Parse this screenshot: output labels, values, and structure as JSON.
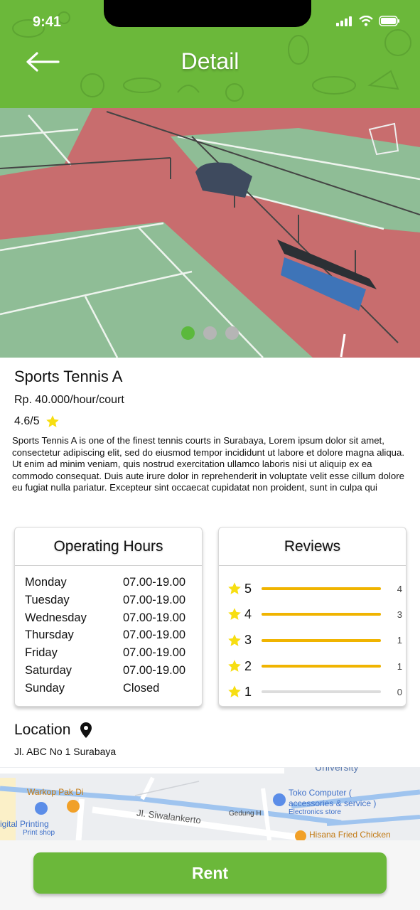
{
  "status_bar": {
    "time": "9:41"
  },
  "header": {
    "title": "Detail",
    "back_icon": "arrow-left-icon",
    "accent": "#6bb83a"
  },
  "hero": {
    "slide_count": 3,
    "active_slide": 1,
    "active_color": "#5bb93c"
  },
  "venue": {
    "name": "Sports Tennis A",
    "price": "Rp. 40.000/hour/court",
    "rating": "4.6/5",
    "description": "Sports Tennis A is one of the finest tennis courts in Surabaya, Lorem ipsum dolor sit amet, consectetur adipiscing elit, sed do eiusmod tempor incididunt ut labore et dolore magna aliqua. Ut enim ad minim veniam, quis nostrud exercitation ullamco laboris nisi ut aliquip ex ea commodo consequat. Duis aute irure dolor in reprehenderit in voluptate velit esse cillum dolore eu fugiat nulla pariatur. Excepteur sint occaecat cupidatat non proident, sunt in culpa qui"
  },
  "operating_hours": {
    "title": "Operating Hours",
    "rows": [
      {
        "day": "Monday",
        "hours": "07.00-19.00"
      },
      {
        "day": "Tuesday",
        "hours": "07.00-19.00"
      },
      {
        "day": "Wednesday",
        "hours": "07.00-19.00"
      },
      {
        "day": "Thursday",
        "hours": "07.00-19.00"
      },
      {
        "day": "Friday",
        "hours": "07.00-19.00"
      },
      {
        "day": "Saturday",
        "hours": "07.00-19.00"
      },
      {
        "day": "Sunday",
        "hours": "Closed"
      }
    ]
  },
  "reviews": {
    "title": "Reviews",
    "bar_color": "#f0b400",
    "rows": [
      {
        "stars": "5",
        "count": "4",
        "fill": 1.0
      },
      {
        "stars": "4",
        "count": "3",
        "fill": 1.0
      },
      {
        "stars": "3",
        "count": "1",
        "fill": 1.0
      },
      {
        "stars": "2",
        "count": "1",
        "fill": 1.0
      },
      {
        "stars": "1",
        "count": "0",
        "fill": 0.0
      }
    ]
  },
  "location": {
    "title": "Location",
    "address": "Jl. ABC No 1 Surabaya",
    "map_labels": {
      "university": "University",
      "warkop": "Warkop Pak Di",
      "toko": "Toko Computer (",
      "toko2": "accessories & service )",
      "electronics": "Electronics store",
      "street": "Jl. Siwalankerto",
      "gedung": "Gedung H",
      "printing": "igital Printing",
      "print_shop": "Print shop",
      "hisana": "Hisana Fried Chicken"
    }
  },
  "actions": {
    "rent_label": "Rent"
  }
}
